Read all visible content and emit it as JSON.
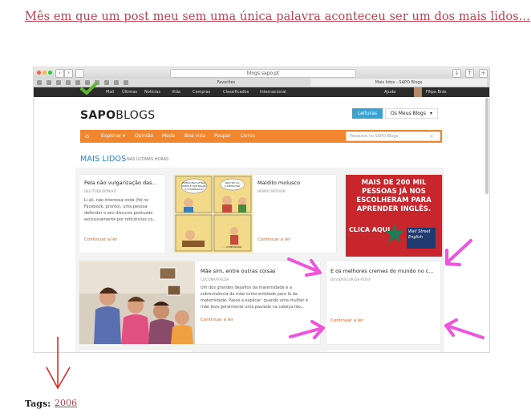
{
  "post": {
    "title": "Mês em que um post meu sem uma única palavra aconteceu ser um dos mais lidos..."
  },
  "browser": {
    "address": "blogs.sapo.pt",
    "tabs": [
      "Favorites",
      "Mais lidos - SAPO Blogs"
    ]
  },
  "sapo_bar": {
    "items": [
      "Mail",
      "Últimas",
      "Notícias",
      "Vida",
      "Compras",
      "Classificados",
      "Internacional"
    ],
    "help": "Ajuda",
    "user": "Filipa Brás"
  },
  "header": {
    "brand_bold": "SAPO",
    "brand_light": "BLOGS",
    "leituras": "Leituras",
    "meus_blogs": "Os Meus Blogs"
  },
  "menu": {
    "items": [
      "Explorar ▾",
      "Opinião",
      "Moda",
      "Boa vida",
      "Poupar",
      "Livros"
    ],
    "search_placeholder": "Pesquise no SAPO Blogs"
  },
  "section": {
    "title": "MAIS LIDOS",
    "subtitle": "NAS ÚLTIMAS HORAS"
  },
  "cards": [
    {
      "title": "Pela não vulgarização das...",
      "source": "DELITODEOPINIAO",
      "excerpt": "Li ali, não interessa onde (foi no Facebook, pronto), uma pessoa defender o seu discurso pontuado exclusivamente por reticências co...",
      "cta": "Continuar a ler"
    },
    {
      "title": "Maldito molusco",
      "source": "HENRICARTOON",
      "cta": "Continuar a ler",
      "comic_text_1": "ENTÃO MAS AFINAL QUEM É QUE PAGOU O CHURRASCO?",
      "comic_text_2": "NÃO SEI CÁ. O MEXILHÃO.",
      "comic_text_3": "... O MEXILHÃO."
    },
    {
      "ad_text": "MAIS DE 200 MIL PESSOAS JÁ NOS ESCOLHERAM PARA APRENDER INGLÊS.",
      "ad_cta": "CLICA AQUI",
      "ad_brand": "Wall Street English"
    },
    {
      "title": "Mãe sim, entre outras coisas",
      "source": "COCONAFRALDA",
      "excerpt": "Um dos grandes desafios da maternidade é a sobrevivência da mãe como entidade para lá da maternidade. Passo a explicar: quando uma mulher é mãe leva geralmente uma paulada na cabeça tão...",
      "cta": "Continuar a ler"
    },
    {
      "title": "E os melhores cremes do mundo no c...",
      "source": "DUVIDASCOR-DE-ROSA",
      "cta": "Continuar a ler"
    }
  ],
  "footer": {
    "tags_label": "Tags:",
    "tag": "2006"
  },
  "colors": {
    "link": "#c0404f",
    "orange": "#f2862f",
    "blue": "#2b7fc0",
    "annotation_arrow": "#ee55dd",
    "red_arrow": "#e02020"
  }
}
